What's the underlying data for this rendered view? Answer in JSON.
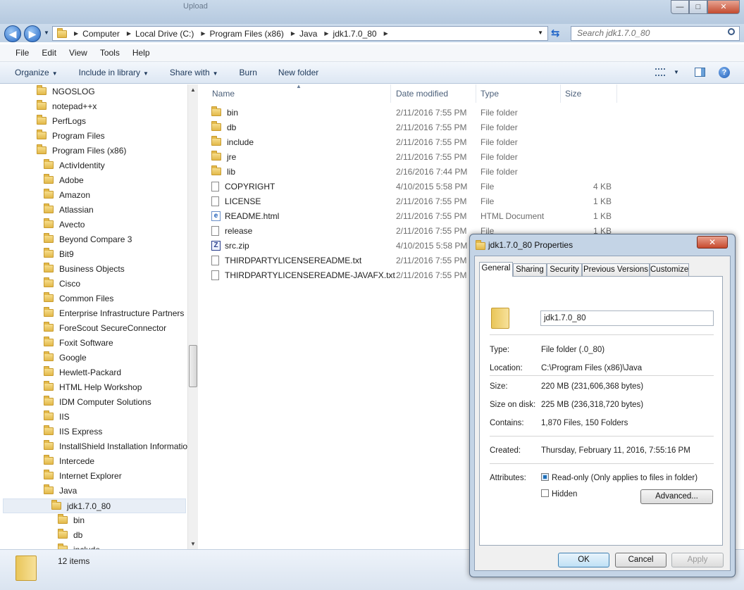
{
  "window": {
    "title": "Upload",
    "controls": {
      "minimize": "—",
      "maximize": "□",
      "close": "✕"
    }
  },
  "address": {
    "crumbs": [
      "Computer",
      "Local Drive (C:)",
      "Program Files (x86)",
      "Java",
      "jdk1.7.0_80"
    ],
    "search_placeholder": "Search jdk1.7.0_80"
  },
  "menu": [
    "File",
    "Edit",
    "View",
    "Tools",
    "Help"
  ],
  "toolbar": {
    "organize": "Organize",
    "include_in_library": "Include in library",
    "share_with": "Share with",
    "burn": "Burn",
    "new_folder": "New folder"
  },
  "nav": {
    "items": [
      {
        "label": "NGOSLOG",
        "level": 1
      },
      {
        "label": "notepad++x",
        "level": 1
      },
      {
        "label": "PerfLogs",
        "level": 1
      },
      {
        "label": "Program Files",
        "level": 1
      },
      {
        "label": "Program Files (x86)",
        "level": 1
      },
      {
        "label": "ActivIdentity",
        "level": 2
      },
      {
        "label": "Adobe",
        "level": 2
      },
      {
        "label": "Amazon",
        "level": 2
      },
      {
        "label": "Atlassian",
        "level": 2
      },
      {
        "label": "Avecto",
        "level": 2
      },
      {
        "label": "Beyond Compare 3",
        "level": 2
      },
      {
        "label": "Bit9",
        "level": 2
      },
      {
        "label": "Business Objects",
        "level": 2
      },
      {
        "label": "Cisco",
        "level": 2
      },
      {
        "label": "Common Files",
        "level": 2
      },
      {
        "label": "Enterprise Infrastructure Partners",
        "level": 2
      },
      {
        "label": "ForeScout SecureConnector",
        "level": 2
      },
      {
        "label": "Foxit Software",
        "level": 2
      },
      {
        "label": "Google",
        "level": 2
      },
      {
        "label": "Hewlett-Packard",
        "level": 2
      },
      {
        "label": "HTML Help Workshop",
        "level": 2
      },
      {
        "label": "IDM Computer Solutions",
        "level": 2
      },
      {
        "label": "IIS",
        "level": 2
      },
      {
        "label": "IIS Express",
        "level": 2
      },
      {
        "label": "InstallShield Installation Informatio",
        "level": 2
      },
      {
        "label": "Intercede",
        "level": 2
      },
      {
        "label": "Internet Explorer",
        "level": 2
      },
      {
        "label": "Java",
        "level": 2
      },
      {
        "label": "jdk1.7.0_80",
        "level": 3,
        "selected": true
      },
      {
        "label": "bin",
        "level": 4
      },
      {
        "label": "db",
        "level": 4
      },
      {
        "label": "include",
        "level": 4
      }
    ]
  },
  "columns": {
    "name": "Name",
    "date": "Date modified",
    "type": "Type",
    "size": "Size"
  },
  "files": [
    {
      "name": "bin",
      "date": "2/11/2016 7:55 PM",
      "type": "File folder",
      "size": "",
      "icon": "folder"
    },
    {
      "name": "db",
      "date": "2/11/2016 7:55 PM",
      "type": "File folder",
      "size": "",
      "icon": "folder"
    },
    {
      "name": "include",
      "date": "2/11/2016 7:55 PM",
      "type": "File folder",
      "size": "",
      "icon": "folder"
    },
    {
      "name": "jre",
      "date": "2/11/2016 7:55 PM",
      "type": "File folder",
      "size": "",
      "icon": "folder"
    },
    {
      "name": "lib",
      "date": "2/16/2016 7:44 PM",
      "type": "File folder",
      "size": "",
      "icon": "folder"
    },
    {
      "name": "COPYRIGHT",
      "date": "4/10/2015 5:58 PM",
      "type": "File",
      "size": "4 KB",
      "icon": "file"
    },
    {
      "name": "LICENSE",
      "date": "2/11/2016 7:55 PM",
      "type": "File",
      "size": "1 KB",
      "icon": "file"
    },
    {
      "name": "README.html",
      "date": "2/11/2016 7:55 PM",
      "type": "HTML Document",
      "size": "1 KB",
      "icon": "html"
    },
    {
      "name": "release",
      "date": "2/11/2016 7:55 PM",
      "type": "File",
      "size": "1 KB",
      "icon": "file"
    },
    {
      "name": "src.zip",
      "date": "4/10/2015 5:58 PM",
      "type": "",
      "size": "",
      "icon": "zip"
    },
    {
      "name": "THIRDPARTYLICENSEREADME.txt",
      "date": "2/11/2016 7:55 PM",
      "type": "",
      "size": "",
      "icon": "file"
    },
    {
      "name": "THIRDPARTYLICENSEREADME-JAVAFX.txt",
      "date": "2/11/2016 7:55 PM",
      "type": "",
      "size": "",
      "icon": "file"
    }
  ],
  "status": {
    "items": "12 items"
  },
  "dialog": {
    "title": "jdk1.7.0_80 Properties",
    "tabs": [
      "General",
      "Sharing",
      "Security",
      "Previous Versions",
      "Customize"
    ],
    "name": "jdk1.7.0_80",
    "type_label": "Type:",
    "type_value": "File folder (.0_80)",
    "location_label": "Location:",
    "location_value": "C:\\Program Files (x86)\\Java",
    "size_label": "Size:",
    "size_value": "220 MB (231,606,368 bytes)",
    "size_on_disk_label": "Size on disk:",
    "size_on_disk_value": "225 MB (236,318,720 bytes)",
    "contains_label": "Contains:",
    "contains_value": "1,870 Files, 150 Folders",
    "created_label": "Created:",
    "created_value": "Thursday, February 11, 2016, 7:55:16 PM",
    "attributes_label": "Attributes:",
    "readonly_label": "Read-only (Only applies to files in folder)",
    "hidden_label": "Hidden",
    "advanced_button": "Advanced...",
    "ok": "OK",
    "cancel": "Cancel",
    "apply": "Apply"
  }
}
